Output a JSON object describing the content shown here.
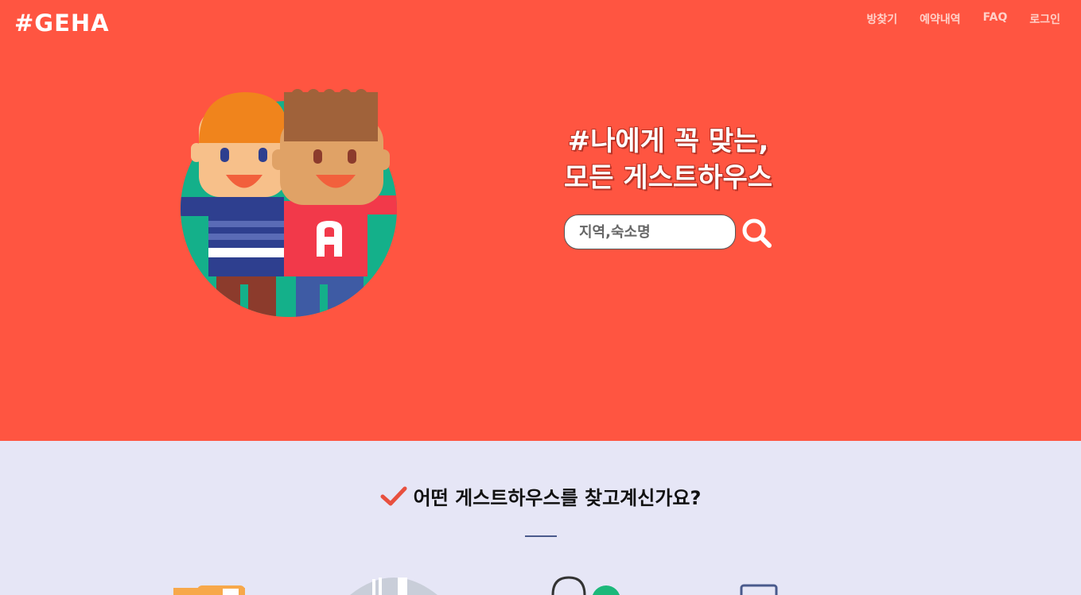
{
  "header": {
    "logo": "#GEHA",
    "nav": [
      {
        "label": "방찾기"
      },
      {
        "label": "예약내역"
      },
      {
        "label": "FAQ"
      },
      {
        "label": "로그인"
      }
    ]
  },
  "hero": {
    "headline_line1": "#나에게 꼭 맞는,",
    "headline_line2": "모든 게스트하우스",
    "search": {
      "placeholder": "지역,숙소명"
    }
  },
  "section": {
    "title": "어떤 게스트하우스를 찾고계신가요?"
  },
  "colors": {
    "hero_bg": "#ff5541",
    "section_bg": "#e6e6f6",
    "accent_check": "#e8503f",
    "divider": "#4a5a8c"
  },
  "icons": [
    "search-icon",
    "check-icon",
    "friends-illustration",
    "category-icons"
  ]
}
